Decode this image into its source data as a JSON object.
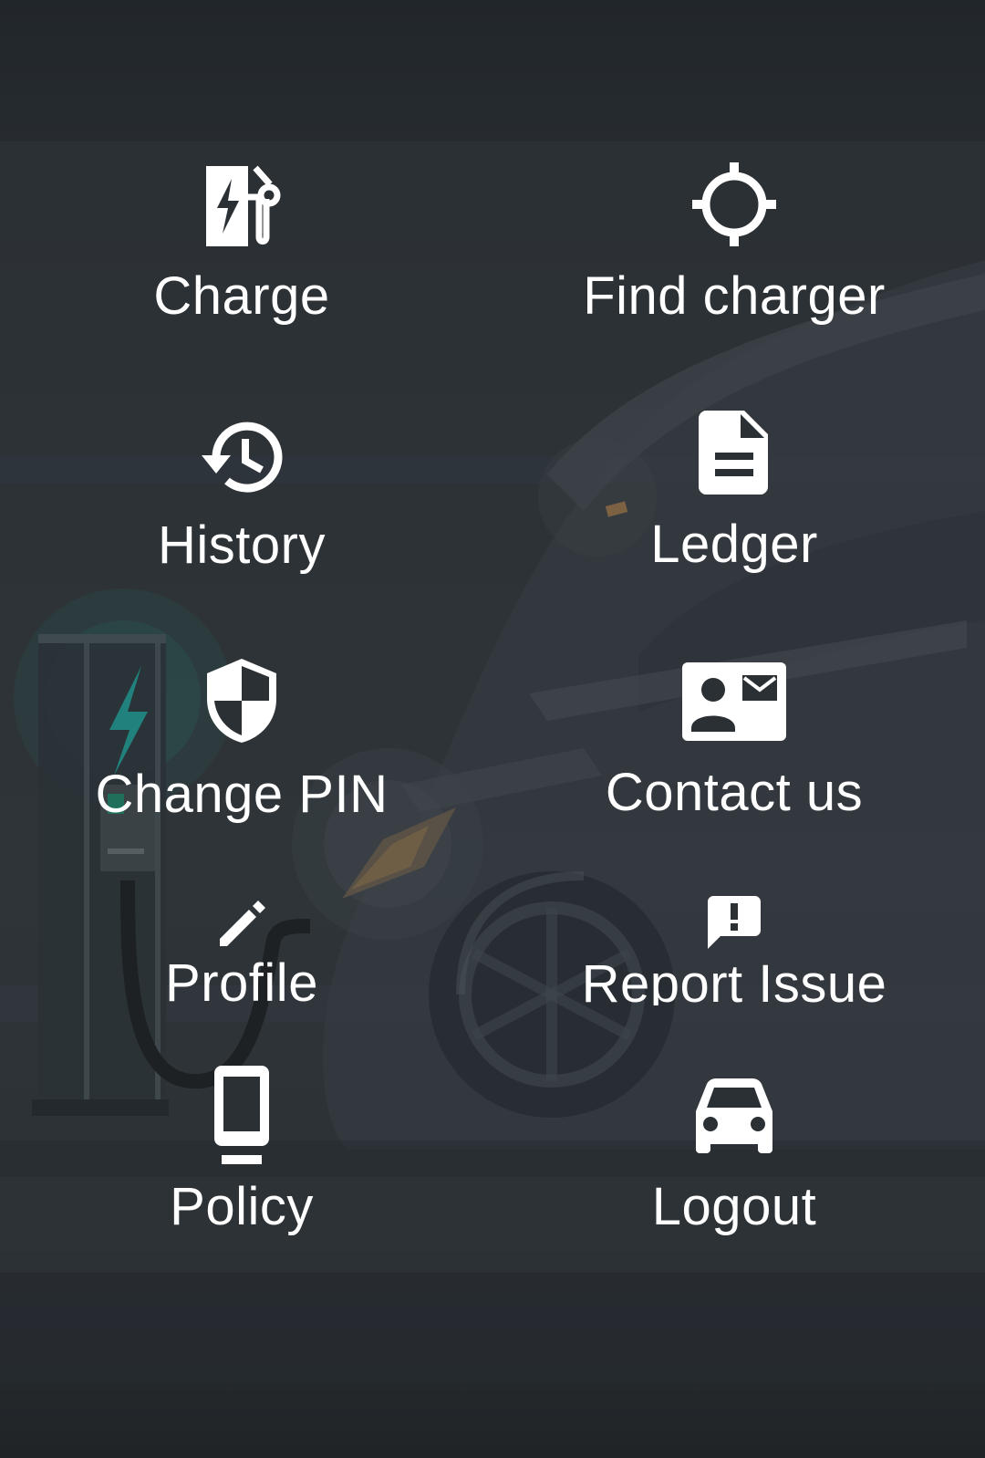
{
  "menu": {
    "items": [
      {
        "id": "charge",
        "label": "Charge",
        "icon": "ev-station-icon"
      },
      {
        "id": "find-charger",
        "label": "Find charger",
        "icon": "crosshair-icon"
      },
      {
        "id": "history",
        "label": "History",
        "icon": "history-icon"
      },
      {
        "id": "ledger",
        "label": "Ledger",
        "icon": "document-icon"
      },
      {
        "id": "change-pin",
        "label": "Change PIN",
        "icon": "shield-icon"
      },
      {
        "id": "contact-us",
        "label": "Contact us",
        "icon": "contact-mail-icon"
      },
      {
        "id": "profile",
        "label": "Profile",
        "icon": "pencil-icon"
      },
      {
        "id": "report-issue",
        "label": "Report Issue",
        "icon": "feedback-icon"
      },
      {
        "id": "policy",
        "label": "Policy",
        "icon": "phone-dock-icon"
      },
      {
        "id": "logout",
        "label": "Logout",
        "icon": "car-icon"
      }
    ]
  },
  "colors": {
    "text": "#ffffff",
    "icon": "#ffffff",
    "background": "#2b3035",
    "accent": "#1f8f8a"
  }
}
